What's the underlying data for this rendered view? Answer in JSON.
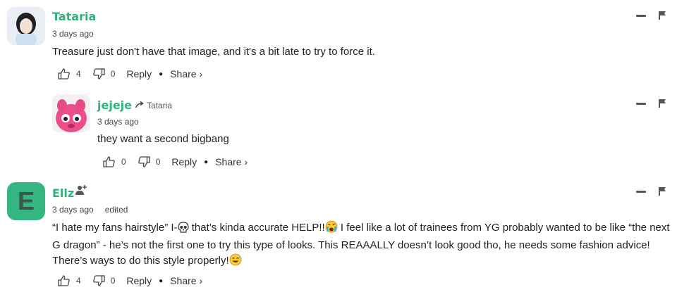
{
  "comments": [
    {
      "author": "Tataria",
      "time": "3 days ago",
      "text": "Treasure just don't have that image, and it's a bit late to try to force it.",
      "likes": "4",
      "dislikes": "0",
      "reply_label": "Reply",
      "share_label": "Share ›"
    },
    {
      "author": "jejeje",
      "reply_to": "Tataria",
      "time": "3 days ago",
      "text": "they want a second bigbang",
      "likes": "0",
      "dislikes": "0",
      "reply_label": "Reply",
      "share_label": "Share ›"
    },
    {
      "author": "Ellz",
      "avatar_letter": "E",
      "time": "3 days ago",
      "edited": "edited",
      "text_1": "“I hate my fans hairstyle” I-",
      "text_2": " that’s kinda accurate HELP!!",
      "text_3": " I feel like a lot of trainees from YG probably wanted to be like “the next G dragon” - he’s not the first one to try this type of looks. This REAAALLY doesn’t look good tho, he needs some fashion advice! There’s ways to do this style properly!",
      "likes": "4",
      "dislikes": "0",
      "reply_label": "Reply",
      "share_label": "Share ›"
    }
  ],
  "colors": {
    "accent": "#2fb27c",
    "avatar_green": "#34b582"
  },
  "icons": [
    "thumbs-up-icon",
    "thumbs-down-icon",
    "minimize-icon",
    "flag-icon",
    "reply-arrow-icon",
    "follow-user-icon",
    "skull-emoji",
    "crying-emoji",
    "sweat-smile-emoji"
  ]
}
